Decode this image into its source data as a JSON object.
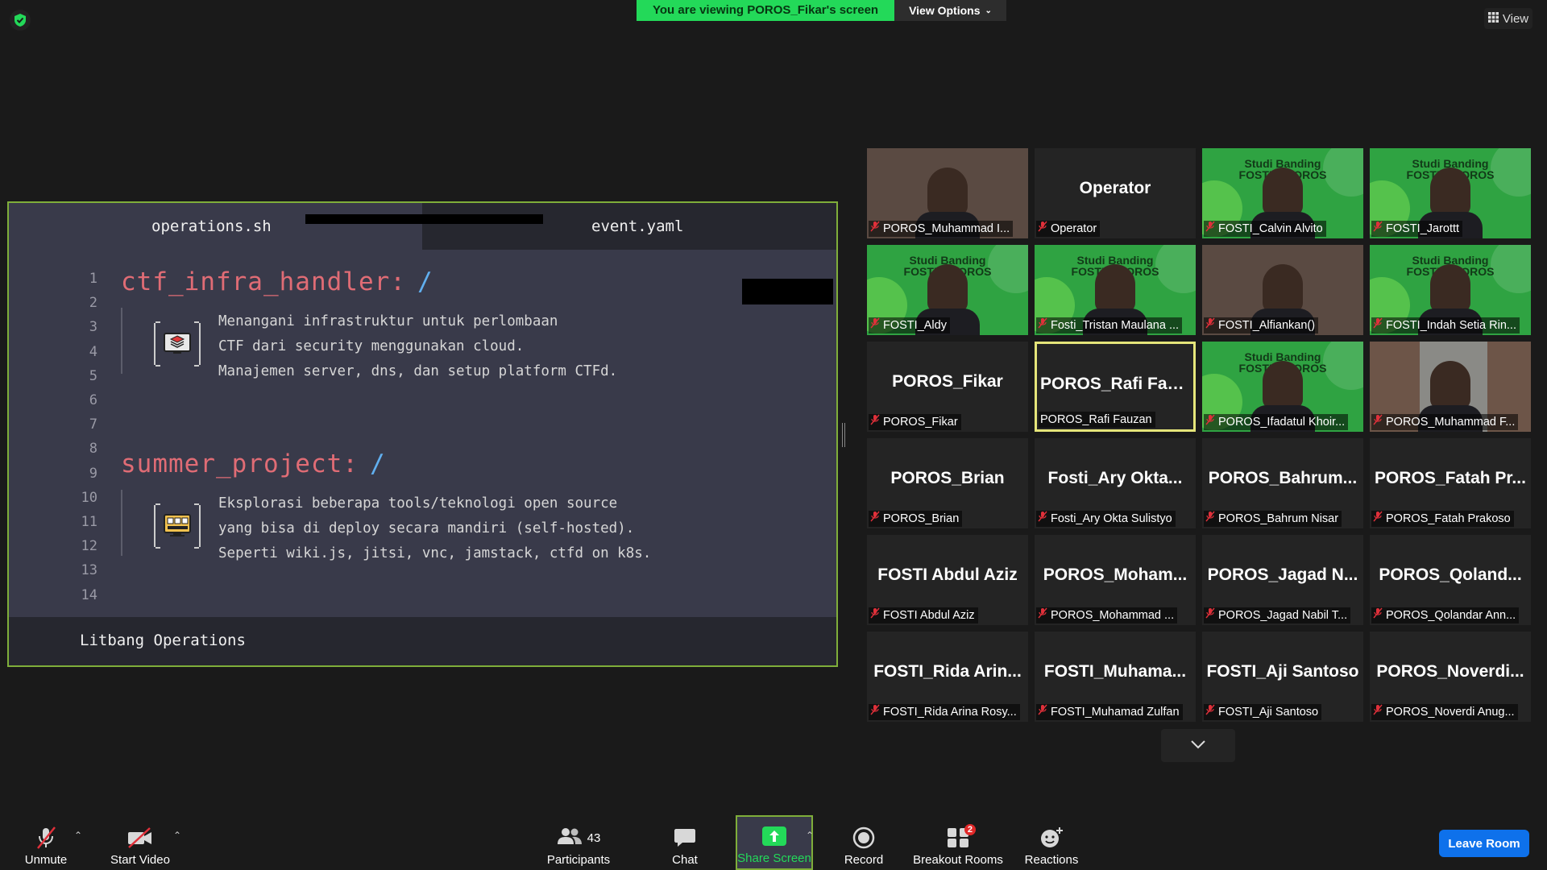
{
  "top": {
    "banner_text": "You are viewing POROS_Fikar's screen",
    "view_options_label": "View Options",
    "view_label": "View"
  },
  "shared_screen": {
    "tabs": [
      "operations.sh",
      "event.yaml"
    ],
    "line_numbers": [
      "1",
      "2",
      "3",
      "4",
      "5",
      "6",
      "7",
      "8",
      "9",
      "10",
      "11",
      "12",
      "13",
      "14"
    ],
    "sections": [
      {
        "title": "ctf_infra_handler",
        "colon": ":",
        "slash": "/",
        "lines": [
          "Menangani infrastruktur untuk perlombaan",
          "CTF dari security menggunakan cloud.",
          "Manajemen server, dns, dan setup platform CTFd."
        ]
      },
      {
        "title": "summer_project",
        "colon": ":",
        "slash": "/",
        "lines": [
          "Eksplorasi beberapa tools/teknologi open source",
          "yang bisa di deploy secara mandiri (self-hosted).",
          "Seperti wiki.js, jitsi, vnc, jamstack, ctfd on k8s."
        ]
      }
    ],
    "footer": "Litbang Operations"
  },
  "gallery": {
    "tiles": [
      {
        "type": "photo",
        "big": "",
        "name": "POROS_Muhammad I..."
      },
      {
        "type": "text",
        "big": "Operator",
        "name": "Operator"
      },
      {
        "type": "green",
        "big": "",
        "name": "FOSTI_Calvin Alvito",
        "banner": "Studi Banding FOSTI X POROS"
      },
      {
        "type": "green",
        "big": "",
        "name": "FOSTI_Jarottt",
        "banner": "Studi Banding FOSTI X POROS"
      },
      {
        "type": "green",
        "big": "",
        "name": "FOSTI_Aldy",
        "banner": "Studi Banding FOSTI X POROS"
      },
      {
        "type": "green",
        "big": "",
        "name": "Fosti_Tristan Maulana ...",
        "banner": "Studi Banding FOSTI X POROS"
      },
      {
        "type": "photo",
        "big": "",
        "name": "FOSTI_Alfiankan()"
      },
      {
        "type": "green",
        "big": "",
        "name": "FOSTI_Indah Setia Rin...",
        "banner": "Studi Banding FOSTI X POROS"
      },
      {
        "type": "text",
        "big": "POROS_Fikar",
        "name": "POROS_Fikar"
      },
      {
        "type": "text",
        "big": "POROS_Rafi  Fau...",
        "name": "POROS_Rafi Fauzan",
        "active": true
      },
      {
        "type": "green",
        "big": "",
        "name": "POROS_Ifadatul Khoir...",
        "banner": "Studi Banding FOSTI X POROS"
      },
      {
        "type": "photo2",
        "big": "",
        "name": "POROS_Muhammad F..."
      },
      {
        "type": "text",
        "big": "POROS_Brian",
        "name": "POROS_Brian"
      },
      {
        "type": "text",
        "big": "Fosti_Ary  Okta...",
        "name": "Fosti_Ary Okta Sulistyo"
      },
      {
        "type": "text",
        "big": "POROS_Bahrum...",
        "name": "POROS_Bahrum Nisar"
      },
      {
        "type": "text",
        "big": "POROS_Fatah  Pr...",
        "name": "POROS_Fatah Prakoso"
      },
      {
        "type": "text",
        "big": "FOSTI Abdul Aziz",
        "name": "FOSTI Abdul Aziz"
      },
      {
        "type": "text",
        "big": "POROS_Moham...",
        "name": "POROS_Mohammad ..."
      },
      {
        "type": "text",
        "big": "POROS_Jagad  N...",
        "name": "POROS_Jagad Nabil T..."
      },
      {
        "type": "text",
        "big": "POROS_Qoland...",
        "name": "POROS_Qolandar Ann..."
      },
      {
        "type": "text",
        "big": "FOSTI_Rida  Arin...",
        "name": "FOSTI_Rida Arina Rosy..."
      },
      {
        "type": "text",
        "big": "FOSTI_Muhama...",
        "name": "FOSTI_Muhamad Zulfan"
      },
      {
        "type": "text",
        "big": "FOSTI_Aji Santoso",
        "name": "FOSTI_Aji Santoso"
      },
      {
        "type": "text",
        "big": "POROS_Noverdi...",
        "name": "POROS_Noverdi Anug..."
      }
    ]
  },
  "toolbar": {
    "unmute": "Unmute",
    "start_video": "Start Video",
    "participants": "Participants",
    "participants_count": "43",
    "chat": "Chat",
    "share_screen": "Share Screen",
    "record": "Record",
    "breakout_rooms": "Breakout Rooms",
    "breakout_badge": "2",
    "reactions": "Reactions",
    "leave_room": "Leave Room"
  },
  "colors": {
    "banner_green": "#23d959",
    "leave_blue": "#0e71eb",
    "active_speaker_border": "#e5e57a",
    "shared_border": "#7fae3a",
    "heading_red": "#e06c75",
    "slash_blue": "#61afef"
  }
}
